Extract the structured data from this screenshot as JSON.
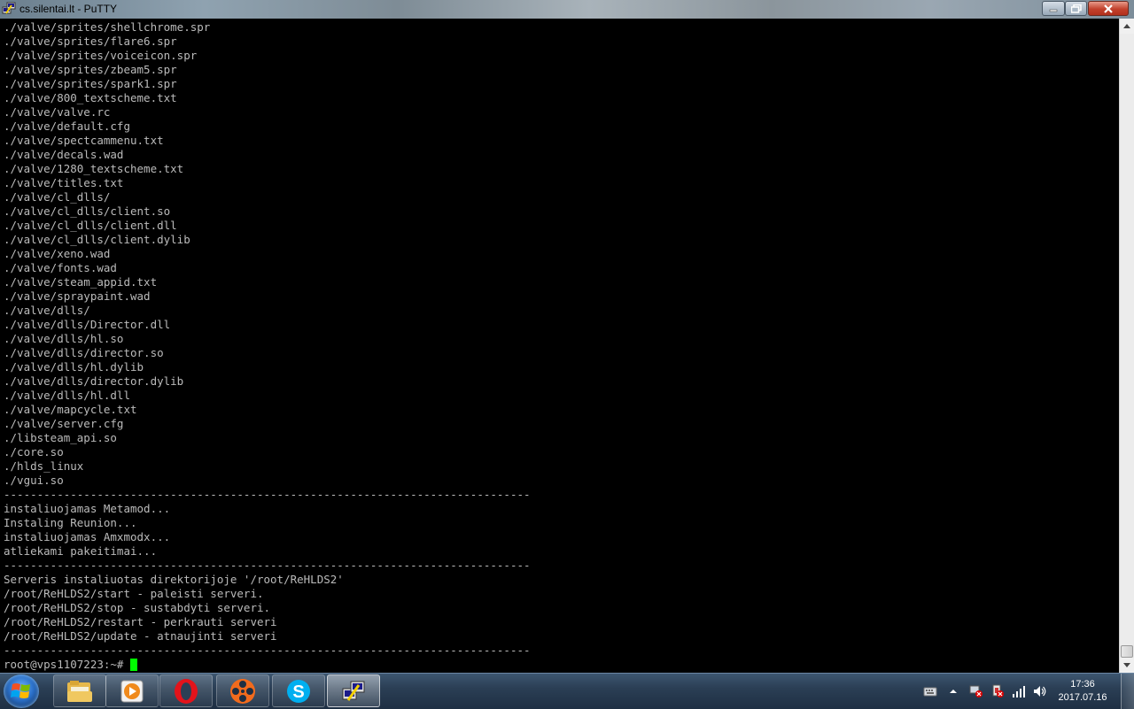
{
  "window": {
    "title": "cs.silentai.lt - PuTTY",
    "icon": "putty-icon",
    "buttons": [
      "minimize-icon",
      "maximize-icon",
      "close-icon"
    ]
  },
  "terminal": {
    "lines": [
      "./valve/sprites/shellchrome.spr",
      "./valve/sprites/flare6.spr",
      "./valve/sprites/voiceicon.spr",
      "./valve/sprites/zbeam5.spr",
      "./valve/sprites/spark1.spr",
      "./valve/800_textscheme.txt",
      "./valve/valve.rc",
      "./valve/default.cfg",
      "./valve/spectcammenu.txt",
      "./valve/decals.wad",
      "./valve/1280_textscheme.txt",
      "./valve/titles.txt",
      "./valve/cl_dlls/",
      "./valve/cl_dlls/client.so",
      "./valve/cl_dlls/client.dll",
      "./valve/cl_dlls/client.dylib",
      "./valve/xeno.wad",
      "./valve/fonts.wad",
      "./valve/steam_appid.txt",
      "./valve/spraypaint.wad",
      "./valve/dlls/",
      "./valve/dlls/Director.dll",
      "./valve/dlls/hl.so",
      "./valve/dlls/director.so",
      "./valve/dlls/hl.dylib",
      "./valve/dlls/director.dylib",
      "./valve/dlls/hl.dll",
      "./valve/mapcycle.txt",
      "./valve/server.cfg",
      "./libsteam_api.so",
      "./core.so",
      "./hlds_linux",
      "./vgui.so",
      "-------------------------------------------------------------------------------",
      "instaliuojamas Metamod...",
      "Instaling Reunion...",
      "instaliuojamas Amxmodx...",
      "atliekami pakeitimai...",
      "-------------------------------------------------------------------------------",
      "Serveris instaliuotas direktorijoje '/root/ReHLDS2'",
      "/root/ReHLDS2/start - paleisti serveri.",
      "/root/ReHLDS2/stop - sustabdyti serveri.",
      "/root/ReHLDS2/restart - perkrauti serveri",
      "/root/ReHLDS2/update - atnaujinti serveri",
      "-------------------------------------------------------------------------------"
    ],
    "prompt": "root@vps1107223:~#",
    "text_color": "#bbbbbb",
    "cursor_color": "#00ff00",
    "background": "#000000"
  },
  "taskbar": {
    "start_icon": "windows-start-icon",
    "apps": [
      {
        "name": "explorer",
        "icon": "folder-icon",
        "state": "pinned"
      },
      {
        "name": "media-player",
        "icon": "media-player-icon",
        "state": "pinned"
      },
      {
        "name": "opera",
        "icon": "opera-icon",
        "state": "pinned"
      },
      {
        "name": "media-center",
        "icon": "film-reel-icon",
        "state": "pinned"
      },
      {
        "name": "skype",
        "icon": "skype-icon",
        "state": "pinned"
      },
      {
        "name": "putty",
        "icon": "putty-icon",
        "state": "active"
      }
    ],
    "tray_icons": [
      "keyboard-icon",
      "show-hidden-icons-chevron",
      "network-error-icon",
      "power-error-icon",
      "signal-icon",
      "volume-icon"
    ],
    "clock": {
      "time": "17:36",
      "date": "2017.07.16"
    }
  }
}
